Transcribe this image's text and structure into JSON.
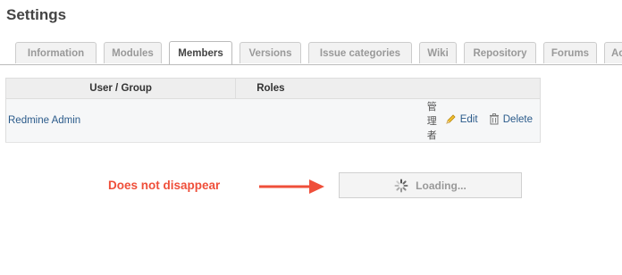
{
  "page": {
    "title": "Settings"
  },
  "tabs": [
    {
      "label": "Information"
    },
    {
      "label": "Modules"
    },
    {
      "label": "Members",
      "selected": true
    },
    {
      "label": "Versions"
    },
    {
      "label": "Issue categories"
    },
    {
      "label": "Wiki"
    },
    {
      "label": "Repository"
    },
    {
      "label": "Forums"
    },
    {
      "label": "Ac"
    }
  ],
  "members": {
    "columns": {
      "user": "User / Group",
      "roles": "Roles"
    },
    "rows": [
      {
        "user": "Redmine Admin",
        "role": "管理者",
        "edit_label": "Edit",
        "delete_label": "Delete"
      }
    ]
  },
  "annotation": {
    "text": "Does not disappear",
    "color": "#ef4f3a"
  },
  "loading": {
    "text": "Loading..."
  },
  "icons": {
    "edit": "pencil-icon",
    "delete": "trash-icon",
    "spinner": "spinner-icon",
    "arrow": "arrow-right-icon"
  }
}
